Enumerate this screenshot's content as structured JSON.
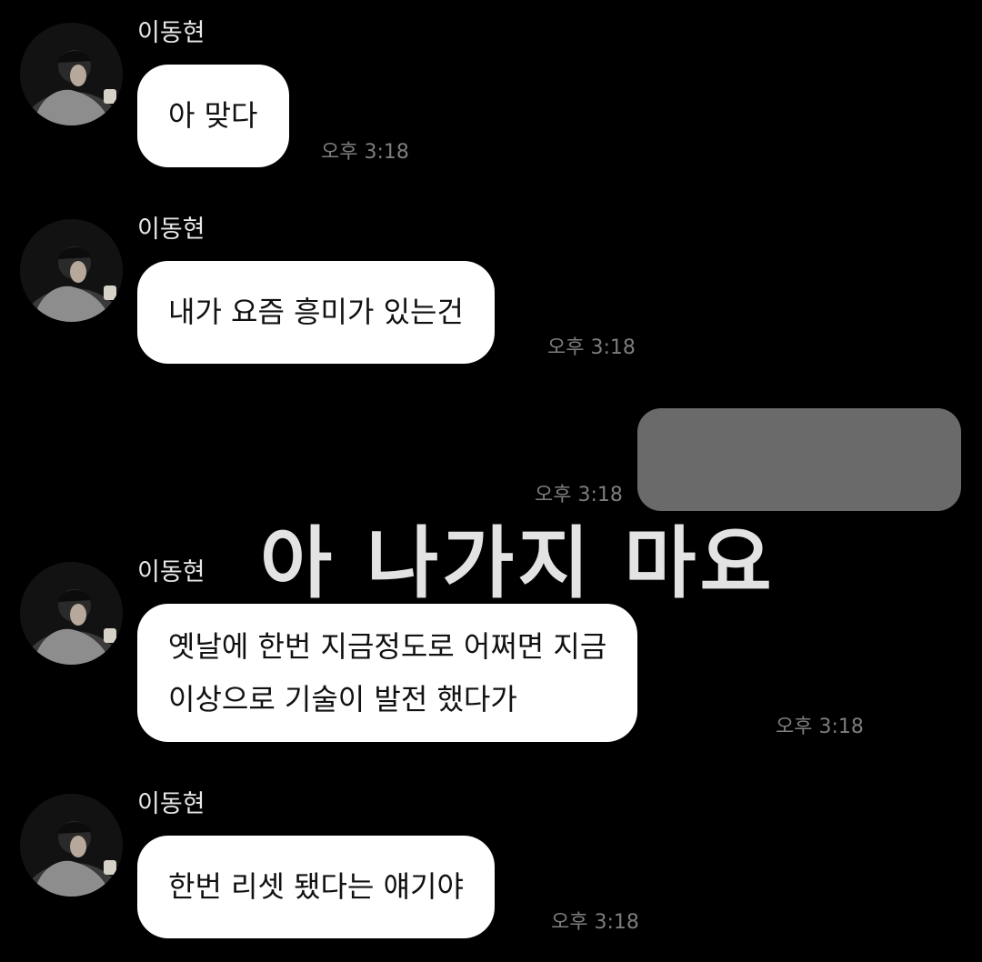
{
  "messages": [
    {
      "sender": "이동현",
      "text": "아 맞다",
      "time": "오후 3:18"
    },
    {
      "sender": "이동현",
      "text": "내가 요즘 흥미가 있는건",
      "time": "오후 3:18"
    },
    {
      "sender": "이동현",
      "lines": [
        "옛날에 한번 지금정도로 어쩌면 지금",
        "이상으로 기술이 발전 했다가"
      ],
      "time": "오후 3:18"
    },
    {
      "sender": "이동현",
      "text": "한번 리셋 됐다는 얘기야",
      "time": "오후 3:18"
    }
  ],
  "outgoing": {
    "time": "오후 3:18",
    "redacted": true
  },
  "overlay_caption": "아 나가지 마요",
  "colors": {
    "background": "#000000",
    "incoming_bubble": "#ffffff",
    "redacted_bubble": "#6a6a6a",
    "timestamp": "#7d7d7d",
    "caption": "#e3e3e3"
  },
  "icons": {
    "avatar": "profile-photo"
  }
}
